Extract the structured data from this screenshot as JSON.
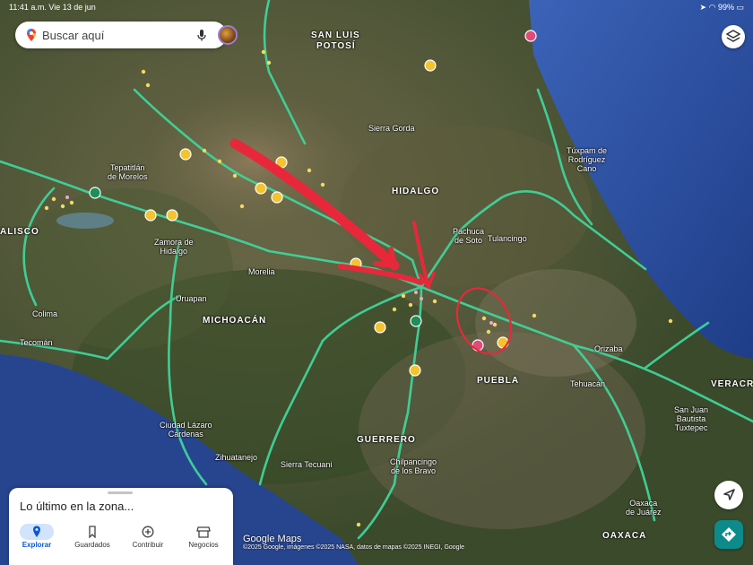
{
  "status_bar": {
    "time": "11:41 a.m.  Vie 13 de jun",
    "battery": "99%"
  },
  "search": {
    "placeholder": "Buscar aquí"
  },
  "map_labels": {
    "san_luis": "SAN LUIS",
    "potosi": "POTOSÍ",
    "sierra_gorda": "Sierra Gorda",
    "hidalgo": "HIDALGO",
    "tuxpam_1": "Túxpam de",
    "tuxpam_2": "Rodríguez",
    "tuxpam_3": "Cano",
    "tepatitlan_1": "Tepatitlán",
    "tepatitlan_2": "de Morelos",
    "jalisco": "ALISCO",
    "zamora_1": "Zamora de",
    "zamora_2": "Hidalgo",
    "pachuca_1": "Pachuca",
    "pachuca_2": "de Soto",
    "tulancingo": "Tulancingo",
    "morelia": "Morelia",
    "uruapan": "Uruapan",
    "michoacan": "MICHOACÁN",
    "colima": "Colima",
    "tecoman": "Tecomán",
    "orizaba": "Orizaba",
    "puebla": "PUEBLA",
    "tehuacan": "Tehuacán",
    "veracruz": "VERACRUZ",
    "san_juan_1": "San Juan",
    "san_juan_2": "Bautista",
    "san_juan_3": "Tuxtepec",
    "lazaro_1": "Ciudad Lázaro",
    "lazaro_2": "Cárdenas",
    "guerrero": "GUERRERO",
    "zihuatanejo": "Zihuatanejo",
    "sierra_tecuani": "Sierra Tecuani",
    "chilpancingo_1": "Chilpancingo",
    "chilpancingo_2": "de los Bravo",
    "oaxaca_city_1": "Oaxaca",
    "oaxaca_city_2": "de Juárez",
    "oaxaca": "OAXACA"
  },
  "bottom_sheet": {
    "title": "Lo último en la zona...",
    "tabs": [
      {
        "label": "Explorar",
        "icon": "location-pin-icon",
        "active": true
      },
      {
        "label": "Guardados",
        "icon": "bookmark-icon",
        "active": false
      },
      {
        "label": "Contribuir",
        "icon": "add-circle-icon",
        "active": false
      },
      {
        "label": "Negocios",
        "icon": "storefront-icon",
        "active": false
      }
    ]
  },
  "attribution": {
    "brand": "Google Maps",
    "copyright": "©2025 Google, imágenes ©2025 NASA, datos de mapas ©2025 INEGI, Google"
  },
  "colors": {
    "road": "#3fd49a",
    "annotation": "#e8283a",
    "water": "#2e4f9e",
    "accent": "#0b57d0"
  }
}
